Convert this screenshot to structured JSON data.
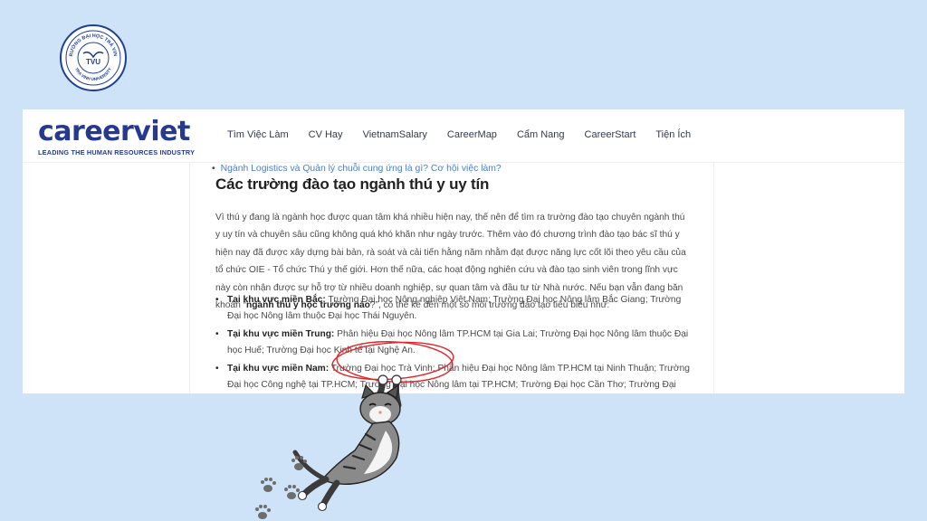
{
  "seal": {
    "top_text": "TRƯỜNG ĐẠI HỌC TRÀ VINH",
    "bottom_text": "TRA VINH UNIVERSITY",
    "center_text": "TVU"
  },
  "header": {
    "logo_word": "careerviet",
    "logo_tagline": "LEADING THE HUMAN RESOURCES INDUSTRY",
    "nav": [
      "Tìm Việc Làm",
      "CV Hay",
      "VietnamSalary",
      "CareerMap",
      "Cẩm Nang",
      "CareerStart",
      "Tiện Ích"
    ]
  },
  "article": {
    "related_link": "Ngành Logistics và Quản lý chuỗi cung ứng là gì? Cơ hội việc làm?",
    "heading": "Các trường đào tạo ngành thú y uy tín",
    "paragraph_before": "Vì thú y đang là ngành học được quan tâm khá nhiều hiện nay, thế nên để tìm ra trường đào tạo chuyên ngành thú y uy tín và chuyên sâu cũng không quá khó khăn như ngày trước. Thêm vào đó chương trình đào tạo bác sĩ thú y hiện nay đã được xây dựng bài bản, rà soát và cải tiến hằng năm nhằm đạt được năng lực cốt lõi theo yêu cầu của tổ chức OIE - Tổ chức Thú y thế giới. Hơn thế nữa, các hoạt động nghiên cứu và đào tạo sinh viên trong lĩnh vực này còn nhận được sự hỗ trợ từ nhiều doanh nghiệp, sự quan tâm và đầu tư từ Nhà nước. Nếu bạn vẫn đang băn khoăn “",
    "paragraph_bold": "ngành thú y học trường nào",
    "paragraph_after": "?”, có thể kể đến một số môi trường đào tạo tiêu biểu như:",
    "regions": [
      {
        "label": "Tại khu vực miền Bắc:",
        "text": " Trường Đại học Nông nghiệp Việt Nam; Trường Đại học Nông lâm Bắc Giang; Trường Đại học Nông lâm thuộc Đại học Thái Nguyên."
      },
      {
        "label": "Tại khu vực miền Trung:",
        "text": " Phân hiệu Đại học Nông lâm TP.HCM tại Gia Lai; Trường Đại học Nông lâm thuộc Đại học Huế; Trường Đại học Kinh tế tại Nghệ An."
      },
      {
        "label": "Tại khu vực miền Nam:",
        "text": " Trường Đại học Trà Vinh; Phân hiệu Đại học Nông lâm TP.HCM tại Ninh Thuận; Trường Đại học Công nghệ tại TP.HCM; Trường Đại học Nông lâm tại TP.HCM; Trường Đại học Cần Thơ; Trường Đại học Tây Đô."
      }
    ]
  },
  "colors": {
    "background": "#cfe3f8",
    "brand": "#253a8e",
    "link": "#4a7ec9",
    "highlight_circle": "#e0262b"
  },
  "decorations": [
    "seal-icon",
    "cat-illustration",
    "paw-print-icon",
    "highlight-circle"
  ]
}
